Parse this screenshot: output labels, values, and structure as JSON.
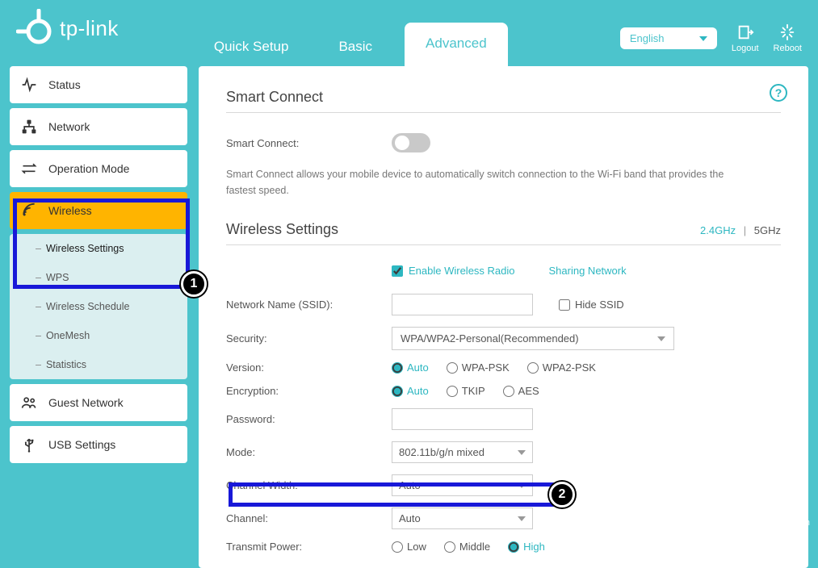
{
  "header": {
    "brand": "tp-link",
    "tabs": {
      "quick_setup": "Quick Setup",
      "basic": "Basic",
      "advanced": "Advanced"
    },
    "language": "English",
    "logout": "Logout",
    "reboot": "Reboot"
  },
  "sidebar": {
    "status": "Status",
    "network": "Network",
    "operation_mode": "Operation Mode",
    "wireless": "Wireless",
    "wireless_sub": {
      "wireless_settings": "Wireless Settings",
      "wps": "WPS",
      "wireless_schedule": "Wireless Schedule",
      "onemesh": "OneMesh",
      "statistics": "Statistics"
    },
    "guest_network": "Guest Network",
    "usb_settings": "USB Settings"
  },
  "smart_connect": {
    "title": "Smart Connect",
    "label": "Smart Connect:",
    "desc": "Smart Connect allows your mobile device to automatically switch connection to the Wi-Fi band that provides the fastest speed."
  },
  "wireless_settings": {
    "title": "Wireless Settings",
    "band_24": "2.4GHz",
    "band_5": "5GHz",
    "enable_radio": "Enable Wireless Radio",
    "sharing_network": "Sharing Network",
    "ssid_label": "Network Name (SSID):",
    "ssid_value": "",
    "hide_ssid": "Hide SSID",
    "security_label": "Security:",
    "security_value": "WPA/WPA2-Personal(Recommended)",
    "version_label": "Version:",
    "version_opts": {
      "auto": "Auto",
      "wpa": "WPA-PSK",
      "wpa2": "WPA2-PSK"
    },
    "encryption_label": "Encryption:",
    "encryption_opts": {
      "auto": "Auto",
      "tkip": "TKIP",
      "aes": "AES"
    },
    "password_label": "Password:",
    "password_value": "",
    "mode_label": "Mode:",
    "mode_value": "802.11b/g/n mixed",
    "channel_width_label": "Channel Width:",
    "channel_width_value": "Auto",
    "channel_label": "Channel:",
    "channel_value": "Auto",
    "transmit_power_label": "Transmit Power:",
    "transmit_power_opts": {
      "low": "Low",
      "middle": "Middle",
      "high": "High"
    }
  },
  "callouts": {
    "one": "1",
    "two": "2"
  },
  "watermark": "wsxdn.com"
}
